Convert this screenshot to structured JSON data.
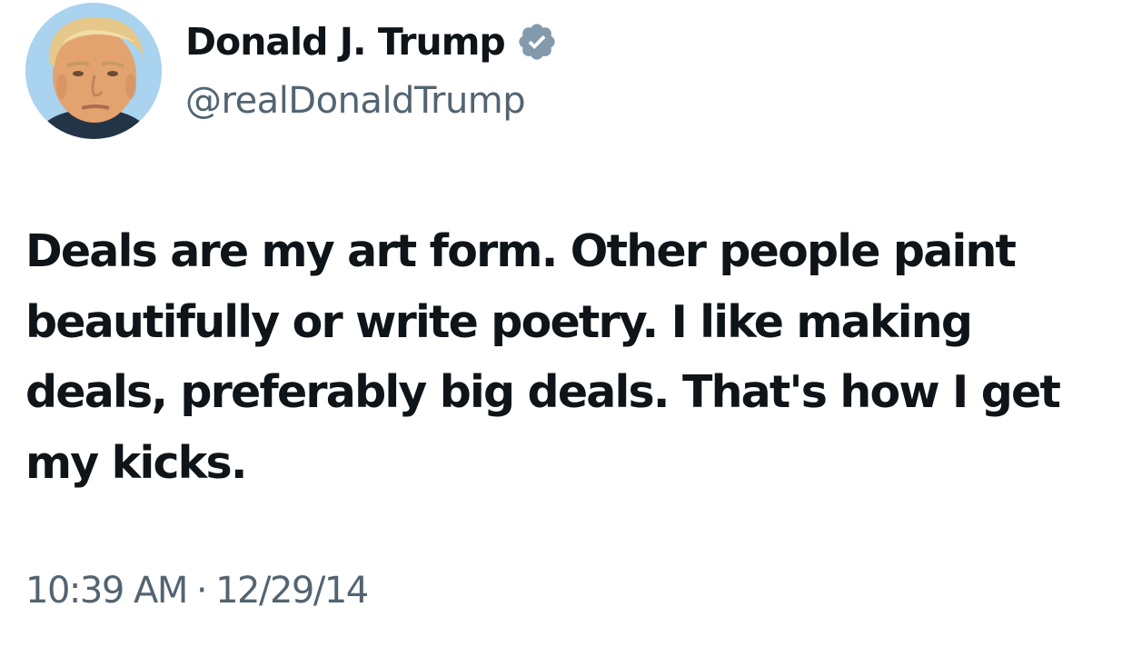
{
  "author": {
    "display_name": "Donald J. Trump",
    "handle": "@realDonaldTrump",
    "verified": true,
    "verified_badge_color": "#829aab"
  },
  "tweet": {
    "text": "Deals are my art form. Other people paint beautifully or write poetry. I like making deals, preferably big deals. That's how I get my kicks.",
    "time": "10:39 AM",
    "separator": "·",
    "date": "12/29/14"
  },
  "colors": {
    "primary_text": "#0f1419",
    "secondary_text": "#536471",
    "avatar_background": "#a9d3ef"
  },
  "icons": {
    "avatar": "profile-photo",
    "badge": "verified-badge-icon"
  }
}
